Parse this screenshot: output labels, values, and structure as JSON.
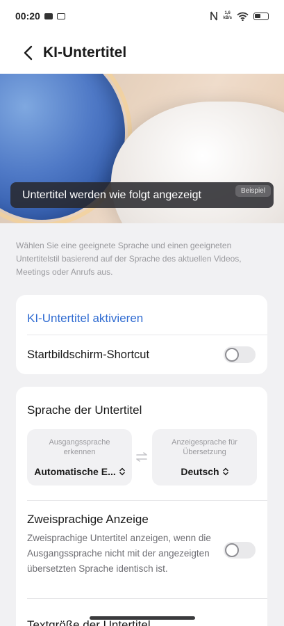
{
  "status_bar": {
    "time": "00:20",
    "net_speed_value": "1,6",
    "net_speed_unit": "kB/s",
    "icons": [
      "youtube-icon",
      "screen-icon",
      "nfc-icon",
      "wifi-icon",
      "battery-icon"
    ]
  },
  "header": {
    "title": "KI-Untertitel"
  },
  "preview": {
    "caption": "Untertitel werden wie folgt angezeigt",
    "badge": "Beispiel"
  },
  "description": "Wählen Sie eine geeignete Sprache und einen geeigneten Untertitelstil basierend auf der Sprache des aktuellen Videos, Meetings oder Anrufs aus.",
  "card_main": {
    "activate_label": "KI-Untertitel aktivieren",
    "shortcut_label": "Startbildschirm-Shortcut",
    "shortcut_on": false
  },
  "language": {
    "section_title": "Sprache der Untertitel",
    "source_label": "Ausgangssprache erkennen",
    "source_value": "Automatische E...",
    "target_label": "Anzeigesprache für Übersetzung",
    "target_value": "Deutsch"
  },
  "bilingual": {
    "title": "Zweisprachige Anzeige",
    "description": "Zweisprachige Untertitel anzeigen, wenn die Ausgangssprache nicht mit der angezeigten übersetzten Sprache identisch ist.",
    "enabled": false
  },
  "text_size": {
    "title": "Textgröße der Untertitel"
  },
  "colors": {
    "accent": "#2f6bd1",
    "background": "#f1f1f3",
    "card": "#ffffff"
  }
}
